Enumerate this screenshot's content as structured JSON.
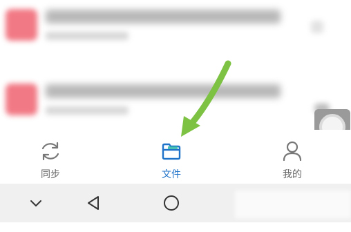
{
  "tabs": {
    "sync": {
      "label": "同步",
      "icon": "sync-icon"
    },
    "files": {
      "label": "文件",
      "icon": "folder-icon",
      "active": true
    },
    "me": {
      "label": "我的",
      "icon": "user-icon"
    }
  },
  "colors": {
    "accent": "#1f73c9",
    "inactive": "#666666",
    "doc_icon": "#f06b78",
    "annotation_arrow": "#7dc243"
  }
}
